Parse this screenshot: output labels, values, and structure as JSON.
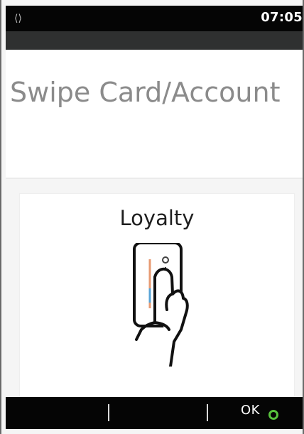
{
  "status_bar": {
    "left_icon": "⟨⟩",
    "left_icon_name": "connection-arrows-icon",
    "time": "07:05"
  },
  "screen": {
    "title": "Swipe Card/Account"
  },
  "option": {
    "label": "Loyalty",
    "icon_name": "swipe-card-icon"
  },
  "button_bar": {
    "ok_label": "OK",
    "ok_indicator_icon": "green-circle-icon",
    "ok_indicator_color": "#58c23d"
  },
  "colors": {
    "title": "#8b8b8b",
    "bars": "#050505",
    "gray_band": "#2f3030"
  }
}
